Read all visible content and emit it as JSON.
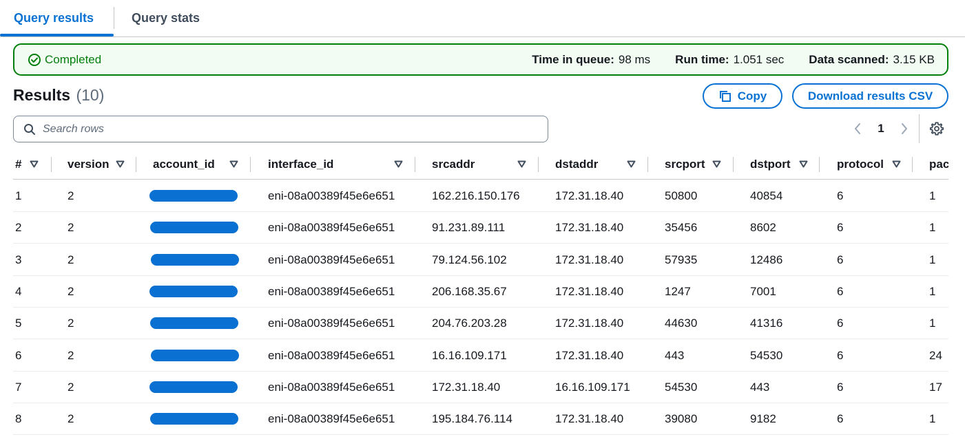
{
  "tabs": [
    {
      "label": "Query results",
      "active": true
    },
    {
      "label": "Query stats",
      "active": false
    }
  ],
  "status": {
    "state": "Completed",
    "color": "#037f0c",
    "stats": [
      {
        "label": "Time in queue:",
        "value": "98 ms"
      },
      {
        "label": "Run time:",
        "value": "1.051 sec"
      },
      {
        "label": "Data scanned:",
        "value": "3.15 KB"
      }
    ]
  },
  "results": {
    "title": "Results",
    "count": "(10)",
    "copy_label": "Copy",
    "download_label": "Download results CSV"
  },
  "search": {
    "placeholder": "Search rows",
    "value": ""
  },
  "pagination": {
    "current_page": "1"
  },
  "accent_color": "#0972d3",
  "table": {
    "columns": [
      "#",
      "version",
      "account_id",
      "interface_id",
      "srcaddr",
      "dstaddr",
      "srcport",
      "dstport",
      "protocol",
      "pac"
    ],
    "rows": [
      [
        "1",
        "2",
        "",
        "eni-08a00389f45e6e651",
        "162.216.150.176",
        "172.31.18.40",
        "50800",
        "40854",
        "6",
        "1"
      ],
      [
        "2",
        "2",
        "",
        "eni-08a00389f45e6e651",
        "91.231.89.111",
        "172.31.18.40",
        "35456",
        "8602",
        "6",
        "1"
      ],
      [
        "3",
        "2",
        "",
        "eni-08a00389f45e6e651",
        "79.124.56.102",
        "172.31.18.40",
        "57935",
        "12486",
        "6",
        "1"
      ],
      [
        "4",
        "2",
        "",
        "eni-08a00389f45e6e651",
        "206.168.35.67",
        "172.31.18.40",
        "1247",
        "7001",
        "6",
        "1"
      ],
      [
        "5",
        "2",
        "",
        "eni-08a00389f45e6e651",
        "204.76.203.28",
        "172.31.18.40",
        "44630",
        "41316",
        "6",
        "1"
      ],
      [
        "6",
        "2",
        "",
        "eni-08a00389f45e6e651",
        "16.16.109.171",
        "172.31.18.40",
        "443",
        "54530",
        "6",
        "24"
      ],
      [
        "7",
        "2",
        "",
        "eni-08a00389f45e6e651",
        "172.31.18.40",
        "16.16.109.171",
        "54530",
        "443",
        "6",
        "17"
      ],
      [
        "8",
        "2",
        "",
        "eni-08a00389f45e6e651",
        "195.184.76.114",
        "172.31.18.40",
        "39080",
        "9182",
        "6",
        "1"
      ]
    ]
  }
}
